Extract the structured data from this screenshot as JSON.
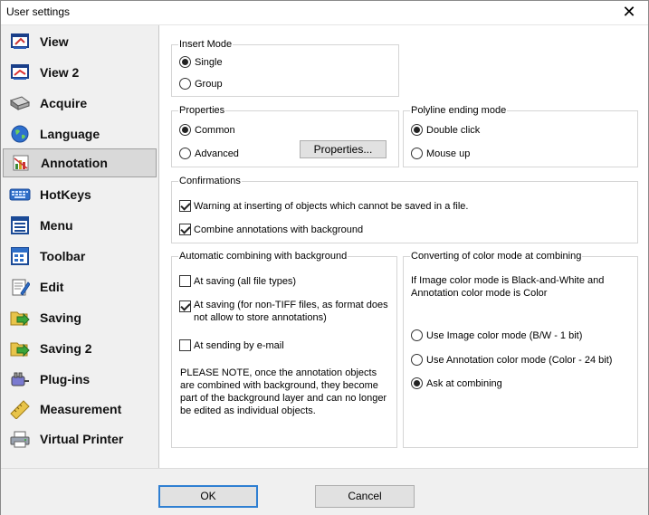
{
  "window": {
    "title": "User settings",
    "close_glyph": "✕"
  },
  "sidebar": {
    "items": [
      {
        "label": "View",
        "icon": "view-icon"
      },
      {
        "label": "View 2",
        "icon": "view2-icon"
      },
      {
        "label": "Acquire",
        "icon": "scanner-icon"
      },
      {
        "label": "Language",
        "icon": "globe-icon"
      },
      {
        "label": "Annotation",
        "icon": "annotation-icon",
        "selected": true
      },
      {
        "label": "HotKeys",
        "icon": "keyboard-icon"
      },
      {
        "label": "Menu",
        "icon": "menu-icon"
      },
      {
        "label": "Toolbar",
        "icon": "toolbar-icon"
      },
      {
        "label": "Edit",
        "icon": "edit-icon"
      },
      {
        "label": "Saving",
        "icon": "saving-icon"
      },
      {
        "label": "Saving 2",
        "icon": "saving2-icon"
      },
      {
        "label": "Plug-ins",
        "icon": "plugin-icon"
      },
      {
        "label": "Measurement",
        "icon": "ruler-icon"
      },
      {
        "label": "Virtual Printer",
        "icon": "printer-icon"
      }
    ]
  },
  "insert_mode": {
    "title": "Insert Mode",
    "options": [
      "Single",
      "Group"
    ],
    "selected": "Single"
  },
  "properties": {
    "title": "Properties",
    "options": [
      "Common",
      "Advanced"
    ],
    "selected": "Common",
    "button_label": "Properties..."
  },
  "polyline": {
    "title": "Polyline ending mode",
    "options": [
      "Double click",
      "Mouse up"
    ],
    "selected": "Double click"
  },
  "confirmations": {
    "title": "Confirmations",
    "items": [
      {
        "label": "Warning at inserting of objects which cannot be saved in a file.",
        "checked": true
      },
      {
        "label": "Combine annotations with background",
        "checked": true
      }
    ]
  },
  "auto_combining": {
    "title": "Automatic combining with background",
    "items": [
      {
        "label": "At saving (all file types)",
        "checked": false
      },
      {
        "label": "At saving (for non-TIFF files, as format does not allow to store annotations)",
        "checked": true
      },
      {
        "label": "At sending by e-mail",
        "checked": false
      }
    ],
    "note": "PLEASE NOTE, once the annotation objects are combined with background, they become part of the background layer and can no longer be edited as individual objects."
  },
  "color_mode": {
    "title": "Converting of color mode at combining",
    "description": "If Image color mode is Black-and-White and Annotation color mode is Color",
    "options": [
      "Use Image color mode (B/W - 1 bit)",
      "Use Annotation color mode (Color - 24 bit)",
      "Ask at combining"
    ],
    "selected": "Ask at combining"
  },
  "buttons": {
    "ok": "OK",
    "cancel": "Cancel"
  },
  "colors": {
    "accent": "#2f7fd2",
    "selected_bg": "#d9d9d9"
  }
}
